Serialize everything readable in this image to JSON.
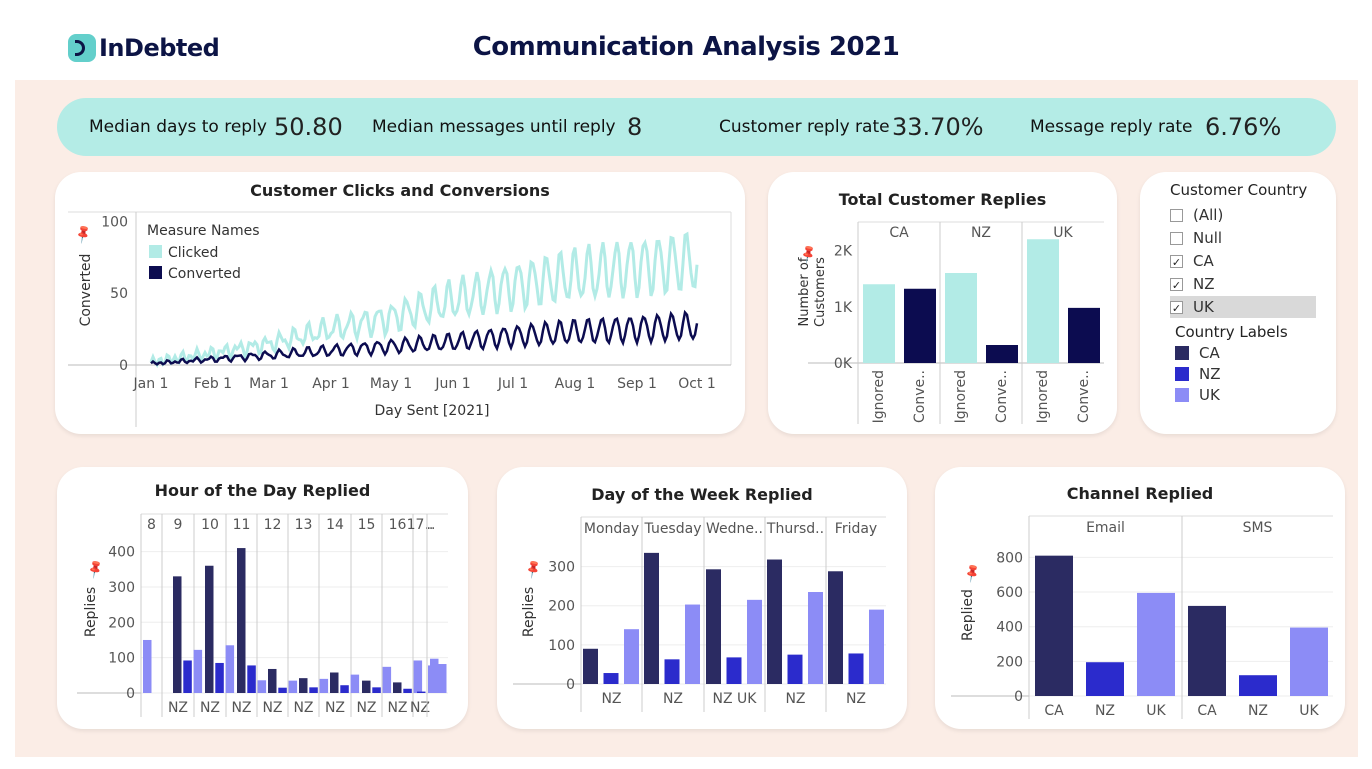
{
  "header": {
    "logo_text": "InDebted",
    "title": "Communication Analysis 2021"
  },
  "kpis": [
    {
      "label": "Median days to reply",
      "value": "50.80"
    },
    {
      "label": "Median messages until reply",
      "value": "8"
    },
    {
      "label": "Customer reply rate",
      "value": "33.70%"
    },
    {
      "label": "Message reply rate",
      "value": "6.76%"
    }
  ],
  "filter": {
    "title": "Customer Country",
    "items": [
      {
        "label": "(All)",
        "checked": ""
      },
      {
        "label": "Null",
        "checked": ""
      },
      {
        "label": "CA",
        "checked": "✓"
      },
      {
        "label": "NZ",
        "checked": "✓"
      },
      {
        "label": "UK",
        "checked": "✓"
      }
    ],
    "legend_title": "Country Labels",
    "legend": [
      {
        "label": "CA",
        "color": "#2b2b62"
      },
      {
        "label": "NZ",
        "color": "#2b2bcc"
      },
      {
        "label": "UK",
        "color": "#8c8cf6"
      }
    ]
  },
  "chart_data": [
    {
      "type": "line",
      "title": "Customer Clicks and Conversions",
      "xlabel": "Day Sent [2021]",
      "ylabel": "Converted",
      "x_ticks": [
        "Jan 1",
        "Feb 1",
        "Mar 1",
        "Apr 1",
        "May 1",
        "Jun 1",
        "Jul 1",
        "Aug 1",
        "Sep 1",
        "Oct 1"
      ],
      "y_ticks": [
        0,
        50,
        100
      ],
      "ylim": [
        0,
        110
      ],
      "legend_title": "Measure Names",
      "series": [
        {
          "name": "Clicked",
          "color": "#b2ebe6",
          "trend": [
            [
              0,
              2
            ],
            [
              30,
              8
            ],
            [
              60,
              15
            ],
            [
              90,
              25
            ],
            [
              120,
              33
            ],
            [
              150,
              45
            ],
            [
              180,
              55
            ],
            [
              210,
              62
            ],
            [
              240,
              68
            ],
            [
              270,
              72
            ]
          ]
        },
        {
          "name": "Converted",
          "color": "#0c0c50",
          "trend": [
            [
              0,
              1
            ],
            [
              30,
              4
            ],
            [
              60,
              7
            ],
            [
              90,
              10
            ],
            [
              120,
              13
            ],
            [
              150,
              16
            ],
            [
              180,
              20
            ],
            [
              210,
              23
            ],
            [
              240,
              25
            ],
            [
              270,
              27
            ]
          ]
        }
      ]
    },
    {
      "type": "bar",
      "title": "Total Customer Replies",
      "ylabel": "Number of Customers",
      "groups": [
        "CA",
        "NZ",
        "UK"
      ],
      "categories": [
        "Ignored",
        "Conve.."
      ],
      "y_ticks": [
        "0K",
        "1K",
        "2K"
      ],
      "ylim": [
        0,
        2400
      ],
      "series": [
        {
          "name": "Ignored",
          "color": "#b2ebe6",
          "values": [
            1400,
            1600,
            2200
          ]
        },
        {
          "name": "Converted",
          "color": "#0c0c50",
          "values": [
            1320,
            320,
            980
          ]
        }
      ]
    },
    {
      "type": "bar",
      "title": "Hour of the Day Replied",
      "ylabel": "Replies",
      "groups": [
        "8",
        "9",
        "10",
        "11",
        "12",
        "13",
        "14",
        "15",
        "16",
        "17..",
        ".."
      ],
      "x_labels": [
        "",
        "NZ",
        "NZ",
        "NZ",
        "NZ",
        "NZ",
        "NZ",
        "NZ",
        "NZ",
        "NZ",
        ""
      ],
      "y_ticks": [
        0,
        100,
        200,
        300,
        400
      ],
      "ylim": [
        0,
        430
      ],
      "series": [
        {
          "name": "CA",
          "values": [
            null,
            330,
            360,
            410,
            68,
            42,
            58,
            35,
            30,
            null,
            null
          ]
        },
        {
          "name": "NZ",
          "values": [
            null,
            92,
            85,
            78,
            15,
            16,
            22,
            16,
            12,
            4,
            null
          ]
        },
        {
          "name": "UK",
          "values": [
            150,
            122,
            135,
            36,
            35,
            40,
            52,
            74,
            92,
            78,
            97
          ]
        }
      ],
      "last_group_extra": [
        82
      ]
    },
    {
      "type": "bar",
      "title": "Day of the Week Replied",
      "ylabel": "Replies",
      "groups": [
        "Monday",
        "Tuesday",
        "Wedne..",
        "Thursd..",
        "Friday"
      ],
      "x_labels": [
        "NZ",
        "NZ",
        "NZ UK",
        "NZ",
        "NZ"
      ],
      "y_ticks": [
        0,
        100,
        200,
        300
      ],
      "ylim": [
        0,
        350
      ],
      "series": [
        {
          "name": "CA",
          "values": [
            90,
            335,
            293,
            318,
            288
          ]
        },
        {
          "name": "NZ",
          "values": [
            28,
            63,
            68,
            75,
            78
          ]
        },
        {
          "name": "UK",
          "values": [
            140,
            203,
            215,
            235,
            190
          ]
        }
      ]
    },
    {
      "type": "bar",
      "title": "Channel Replied",
      "ylabel": "Replied",
      "groups": [
        "Email",
        "SMS"
      ],
      "categories": [
        "CA",
        "NZ",
        "UK"
      ],
      "y_ticks": [
        0,
        200,
        400,
        600,
        800
      ],
      "ylim": [
        0,
        860
      ],
      "series": [
        {
          "name": "CA",
          "values": [
            810,
            520
          ]
        },
        {
          "name": "NZ",
          "values": [
            195,
            120
          ]
        },
        {
          "name": "UK",
          "values": [
            595,
            395
          ]
        }
      ]
    }
  ]
}
